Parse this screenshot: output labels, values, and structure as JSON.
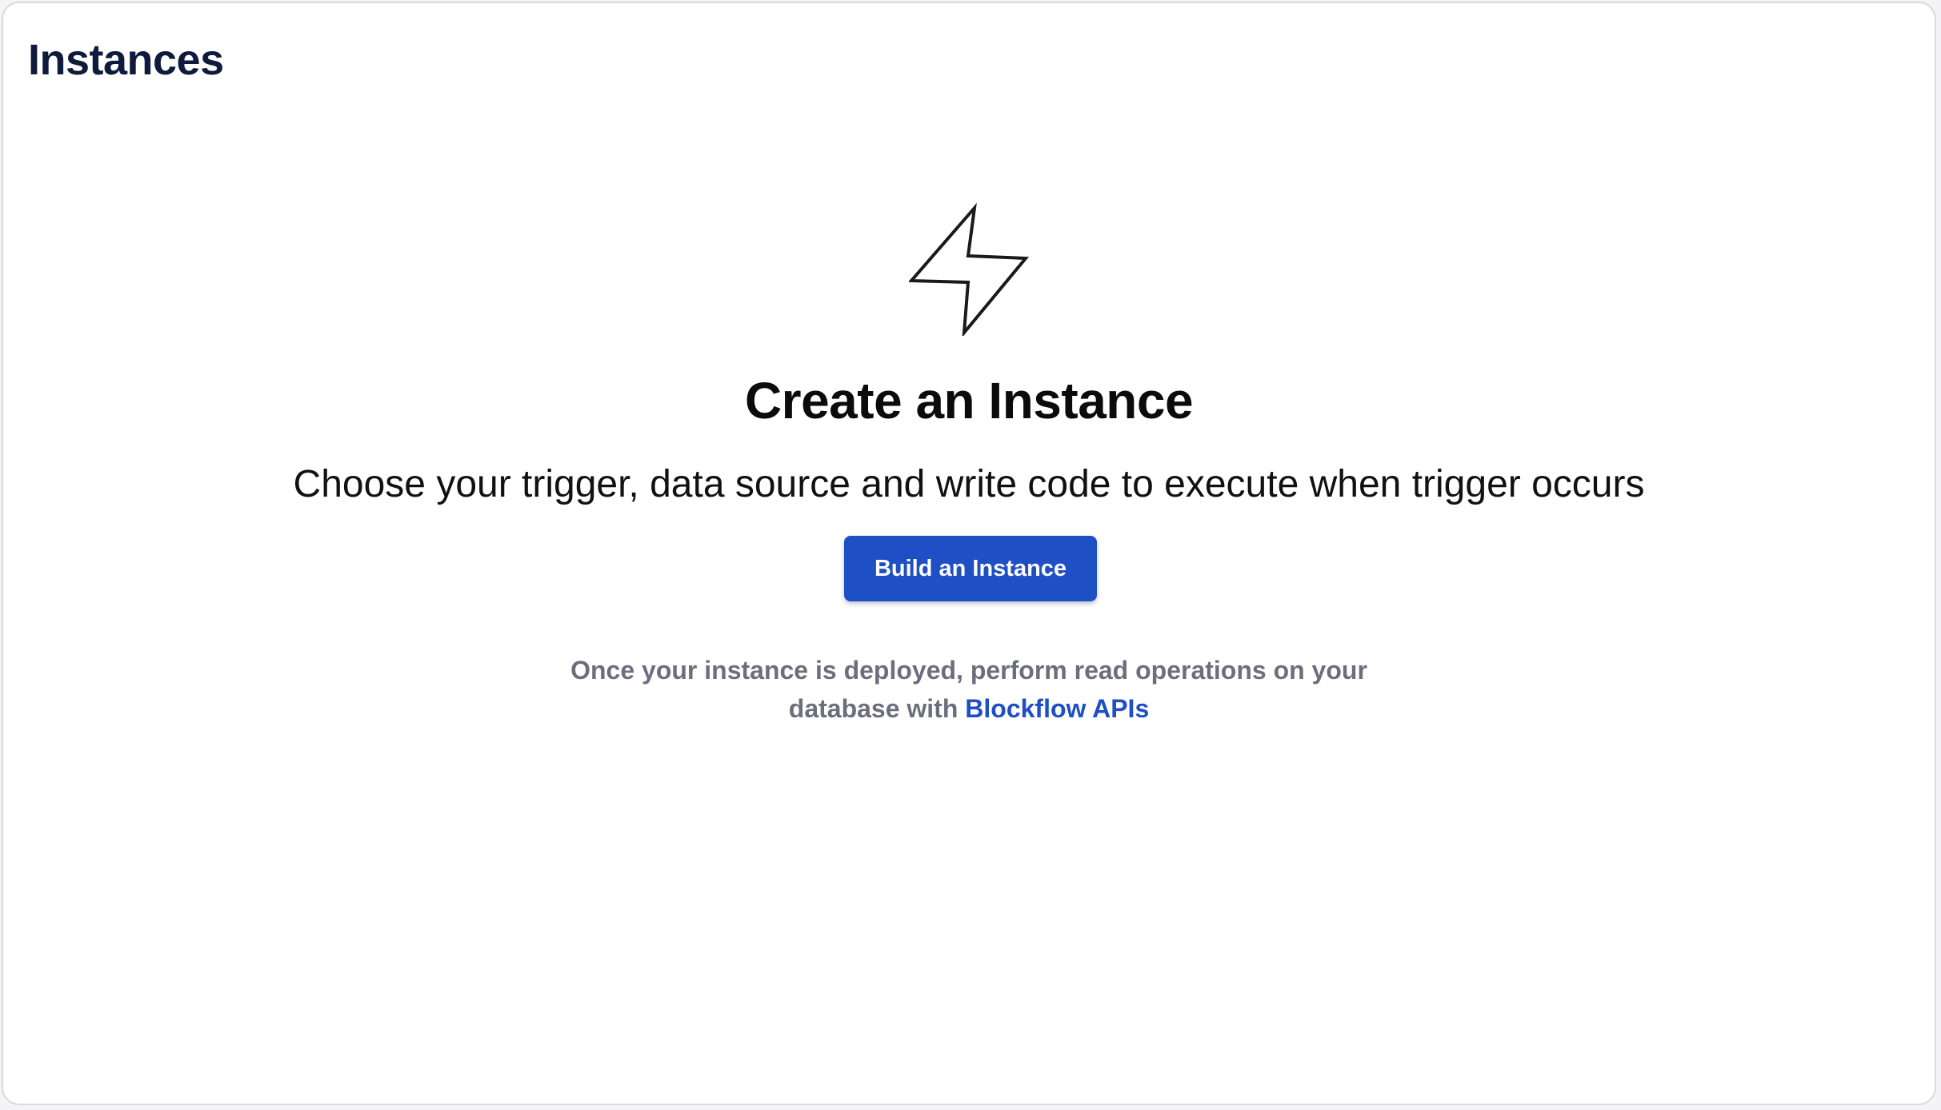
{
  "header": {
    "title": "Instances"
  },
  "empty_state": {
    "icon": "lightning-bolt-icon",
    "title": "Create an Instance",
    "description": "Choose your trigger, data source and write code to execute when trigger occurs",
    "button_label": "Build an Instance",
    "helper_line1": "Once your instance is deployed, perform read operations on your",
    "helper_line2_prefix": "database with",
    "helper_link": "Blockflow APIs"
  },
  "colors": {
    "accent": "#1f4fc4",
    "title": "#0f1b3d",
    "muted": "#6b6f7c"
  }
}
